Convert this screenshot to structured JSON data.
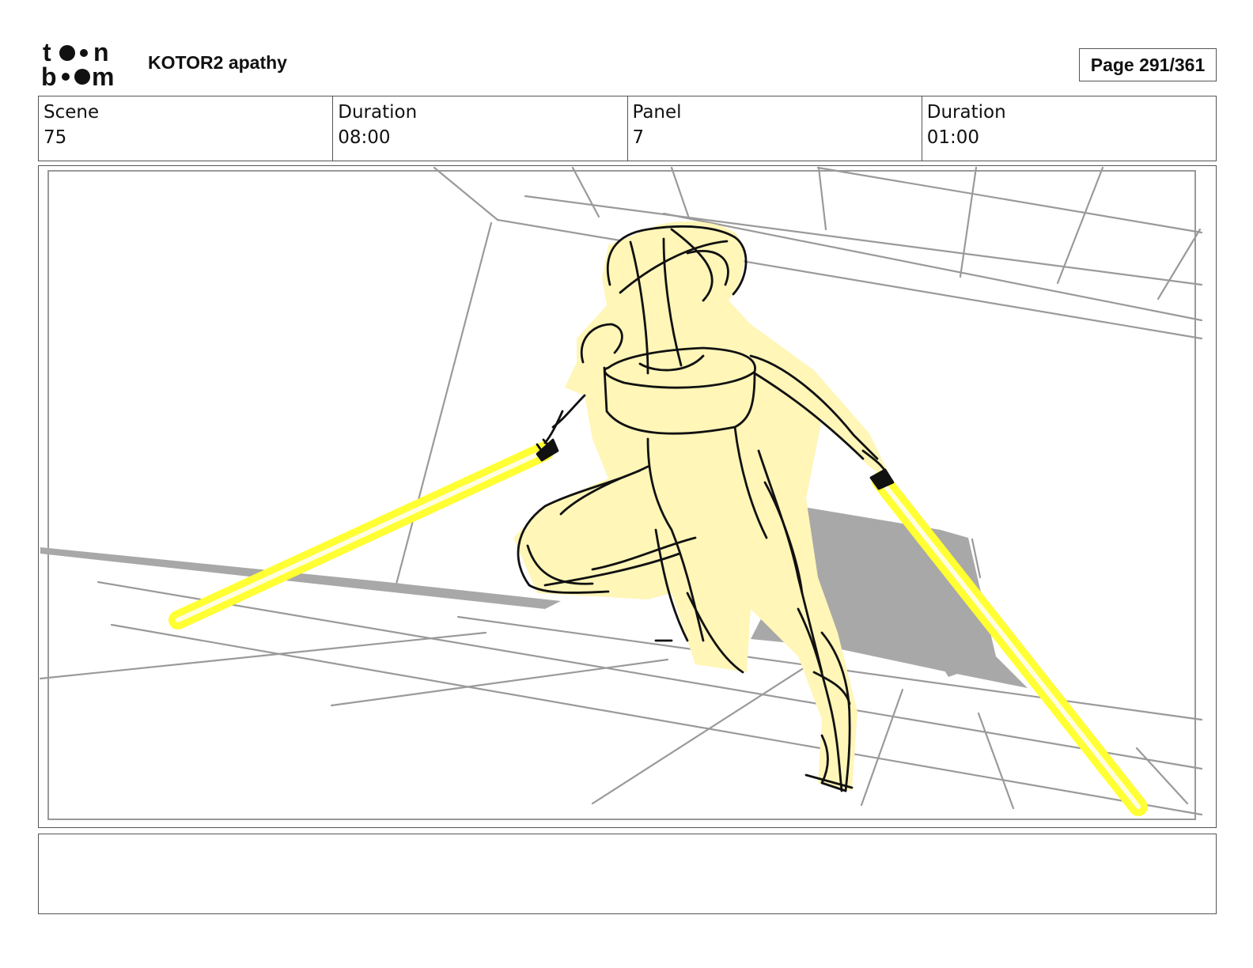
{
  "header": {
    "logo_text": "toon boom",
    "project_title": "KOTOR2 apathy",
    "page_label": "Page 291/361"
  },
  "info": {
    "scene_label": "Scene",
    "scene_value": "75",
    "duration_label": "Duration",
    "duration_value": "08:00",
    "panel_label": "Panel",
    "panel_value": "7",
    "panel_duration_label": "Duration",
    "panel_duration_value": "01:00"
  },
  "notes": {
    "text": ""
  },
  "colors": {
    "border": "#555555",
    "saber": "#ffff33",
    "figure_fill": "#fff6b8",
    "shadow": "#a8a8a8",
    "environment_lines": "#9a9a9a"
  }
}
